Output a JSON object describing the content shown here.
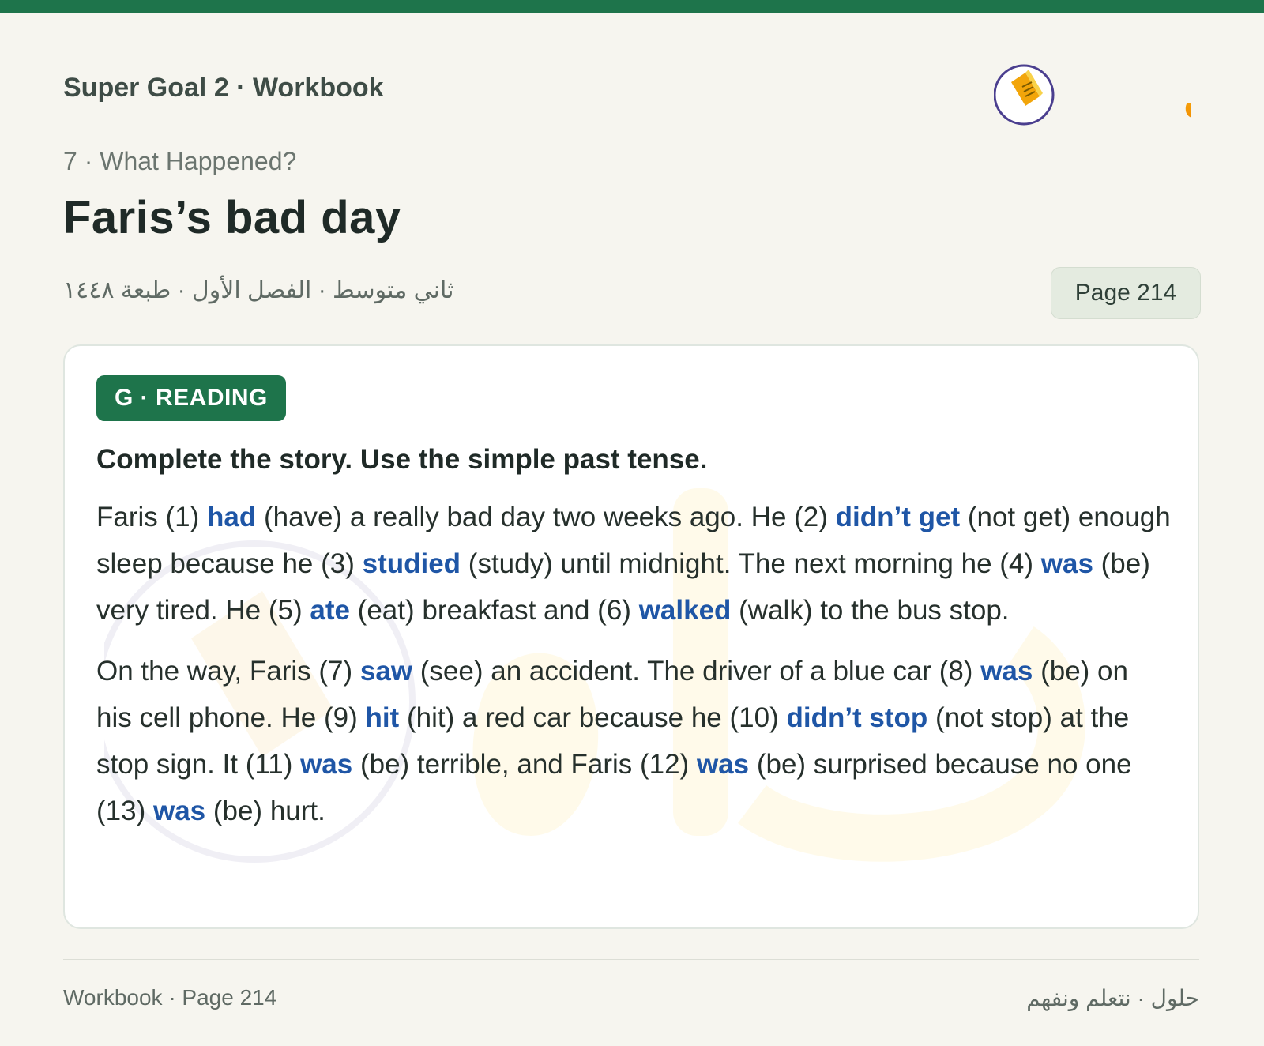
{
  "colors": {
    "brand_green": "#1e744b",
    "answer_blue": "#1f56a6",
    "background": "#f6f5ef",
    "logo_orange": "#f2a50a"
  },
  "header": {
    "book_title": "Super Goal 2 · Workbook",
    "logo": {
      "icon": "hulul-logo",
      "text": "حلول"
    }
  },
  "unit": "7 · What Happened?",
  "title": "Faris’s bad day",
  "meta_ar": "ثاني متوسط · الفصل الأول · طبعة ١٤٤٨",
  "page_badge": "Page 214",
  "exercise": {
    "section_label": "G · READING",
    "instructions": "Complete the story. Use the simple past tense.",
    "paragraphs": [
      [
        {
          "text": "Faris (1) "
        },
        {
          "text": "had",
          "answer": true
        },
        {
          "text": " (have) a really bad day two weeks ago. He (2) "
        },
        {
          "text": "didn’t get",
          "answer": true
        },
        {
          "text": " (not get) enough sleep because he (3) "
        },
        {
          "text": "studied",
          "answer": true
        },
        {
          "text": " (study) until midnight. The next morning he (4) "
        },
        {
          "text": "was",
          "answer": true
        },
        {
          "text": " (be) very tired. He (5) "
        },
        {
          "text": "ate",
          "answer": true
        },
        {
          "text": " (eat) breakfast and (6) "
        },
        {
          "text": "walked",
          "answer": true
        },
        {
          "text": " (walk) to the bus stop."
        }
      ],
      [
        {
          "text": "On the way, Faris (7) "
        },
        {
          "text": "saw",
          "answer": true
        },
        {
          "text": " (see) an accident. The driver of a blue car (8) "
        },
        {
          "text": "was",
          "answer": true
        },
        {
          "text": " (be) on his cell phone. He (9) "
        },
        {
          "text": "hit",
          "answer": true
        },
        {
          "text": " (hit) a red car because he (10) "
        },
        {
          "text": "didn’t stop",
          "answer": true
        },
        {
          "text": " (not stop) at the stop sign. It (11) "
        },
        {
          "text": "was",
          "answer": true
        },
        {
          "text": " (be) terrible, and Faris (12) "
        },
        {
          "text": "was",
          "answer": true
        },
        {
          "text": " (be) surprised because no one (13) "
        },
        {
          "text": "was",
          "answer": true
        },
        {
          "text": " (be) hurt."
        }
      ]
    ]
  },
  "footer": {
    "left": "Workbook · Page 214",
    "right": "حلول · نتعلم ونفهم"
  }
}
